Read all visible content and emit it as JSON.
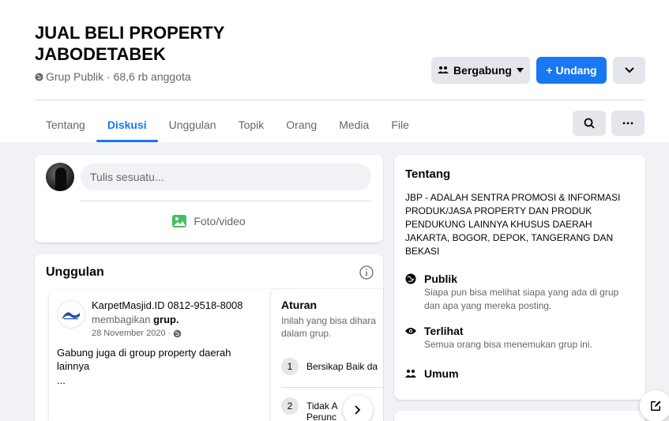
{
  "group": {
    "title": "JUAL BELI PROPERTY JABODETABEK",
    "meta": "Grup Publik · 68,6 rb anggota"
  },
  "actions": {
    "join_label": "Bergabung",
    "invite_label": "+ Undang"
  },
  "tabs": [
    "Tentang",
    "Diskusi",
    "Unggulan",
    "Topik",
    "Orang",
    "Media",
    "File"
  ],
  "active_tab": "Diskusi",
  "composer": {
    "placeholder": "Tulis sesuatu...",
    "photo_label": "Foto/video"
  },
  "featured": {
    "title": "Unggulan",
    "post": {
      "author": "KarpetMasjid.ID 0812-9518-8008",
      "shared_prefix": "membagikan",
      "shared_object": "grup.",
      "date": "28 November 2020 ·",
      "text": "Gabung juga di group property daerah lainnya",
      "ellipsis": "..."
    },
    "rules": {
      "title": "Aturan",
      "desc_line1": "Inilah yang bisa dihara",
      "desc_line2": "dalam grup.",
      "items": [
        {
          "num": "1",
          "text": "Bersikap Baik da"
        },
        {
          "num": "2",
          "text_line1": "Tidak A        ara",
          "text_line2": "Perunc"
        }
      ]
    }
  },
  "about": {
    "title": "Tentang",
    "description": "JBP - ADALAH SENTRA PROMOSI & INFORMASI PRODUK/JASA PROPERTY DAN PRODUK PENDUKUNG LAINNYA KHUSUS DAERAH JAKARTA, BOGOR, DEPOK, TANGERANG DAN BEKASI",
    "items": [
      {
        "icon": "globe-icon",
        "title": "Publik",
        "desc": "Siapa pun bisa melihat siapa yang ada di grup dan apa yang mereka posting."
      },
      {
        "icon": "eye-icon",
        "title": "Terlihat",
        "desc": "Semua orang bisa menemukan grup ini."
      },
      {
        "icon": "people-icon",
        "title": "Umum",
        "desc": ""
      }
    ]
  },
  "colors": {
    "primary": "#1877f2",
    "background": "#f0f2f5",
    "secondary_text": "#65676b",
    "button_gray": "#e4e6eb"
  }
}
